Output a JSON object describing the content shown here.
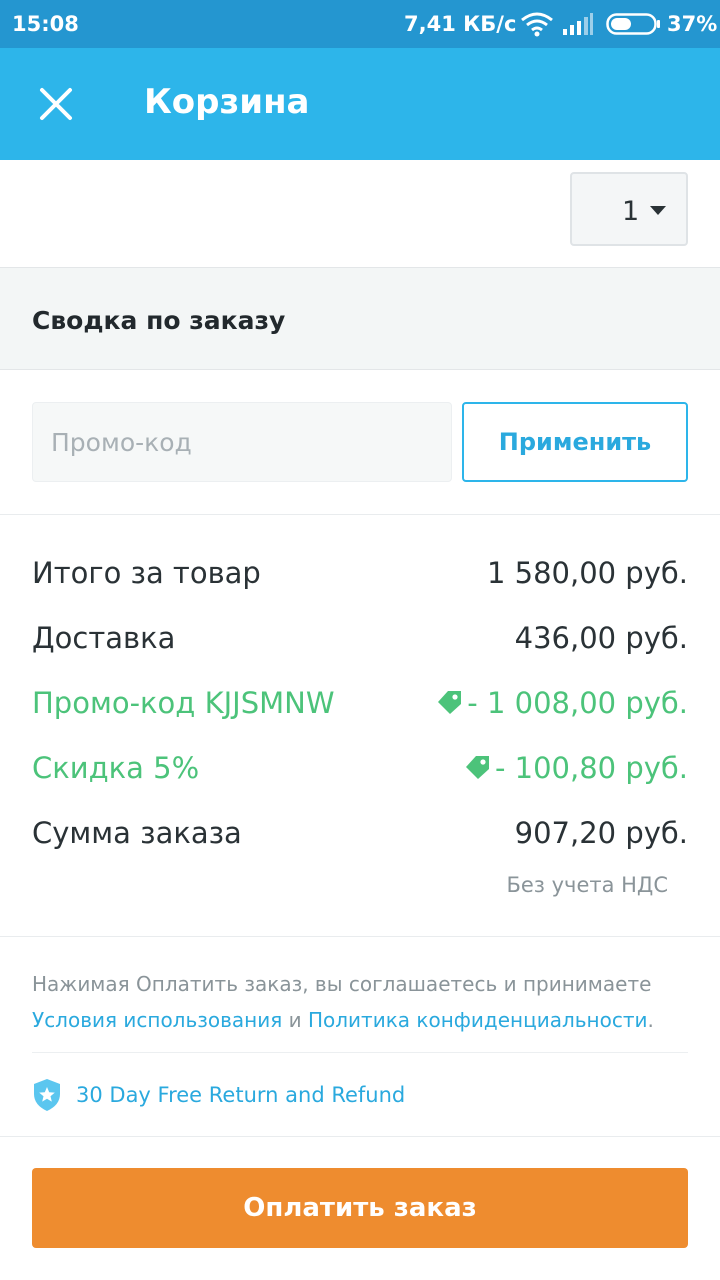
{
  "status_bar": {
    "time": "15:08",
    "network_speed": "7,41 КБ/с",
    "battery": "37%",
    "icons": [
      "wifi-icon",
      "signal-icon",
      "battery-icon"
    ]
  },
  "app_bar": {
    "title": "Корзина",
    "close_icon": "close-icon"
  },
  "item": {
    "quantity": "1"
  },
  "summary": {
    "heading": "Сводка по заказу",
    "promo_placeholder": "Промо-код",
    "apply_label": "Применить",
    "rows": [
      {
        "label": "Итого за товар",
        "amount": "1 580,00 руб."
      },
      {
        "label": "Доставка",
        "amount": "436,00 руб."
      },
      {
        "label": "Промо-код KJJSMNW",
        "amount": "- 1 008,00 руб."
      },
      {
        "label": "Скидка 5%",
        "amount": "- 100,80 руб."
      },
      {
        "label": "Сумма заказа",
        "amount": "907,20 руб."
      }
    ],
    "vat_note": "Без учета НДС"
  },
  "terms": {
    "prefix": "Нажимая Оплатить заказ, вы соглашаетесь и принимаете",
    "terms_link": "Условия использования",
    "conjunction": "и",
    "privacy_link": "Политика конфиденциальности",
    "suffix": "."
  },
  "guarantee": {
    "text": "30 Day Free Return and Refund",
    "icon": "shield-icon"
  },
  "pay_button": "Оплатить заказ",
  "colors": {
    "status_bar": "#2496d0",
    "app_bar": "#2db5ea",
    "accent": "#2db5ea",
    "discount": "#4cc37a",
    "pay_button": "#ee8c2f"
  }
}
